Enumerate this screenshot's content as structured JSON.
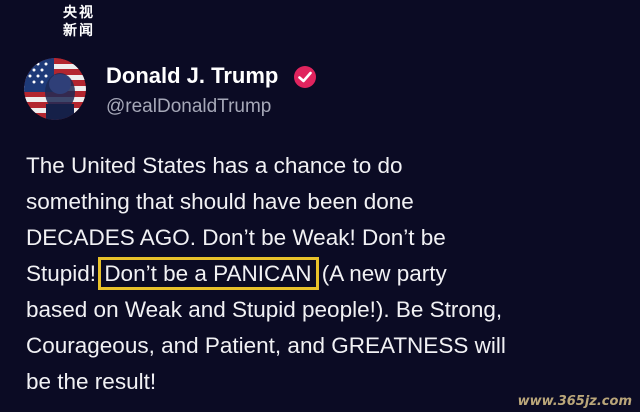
{
  "watermark_top": {
    "line1": "央视",
    "line2": "新闻"
  },
  "profile": {
    "display_name": "Donald J. Trump",
    "handle": "@realDonaldTrump",
    "verified_icon": "verified-badge-icon",
    "verified_color": "#e0245e"
  },
  "post": {
    "lines": [
      "The United States has a chance to do",
      "something that should have been done",
      "DECADES AGO. Don’t be Weak! Don’t be",
      "Stupid! ",
      "based on Weak and Stupid people!). Be Strong,",
      "Courageous, and Patient, and GREATNESS will",
      "be the result!"
    ],
    "highlighted_phrase": "Don’t be a PANICAN",
    "after_highlight": " (A new party",
    "highlight_color": "#e8c12a"
  },
  "watermark_bottom": "www.365jz.com",
  "colors": {
    "background": "#0b0b24",
    "text": "#f1f1f4",
    "handle": "#a6a8b8"
  }
}
